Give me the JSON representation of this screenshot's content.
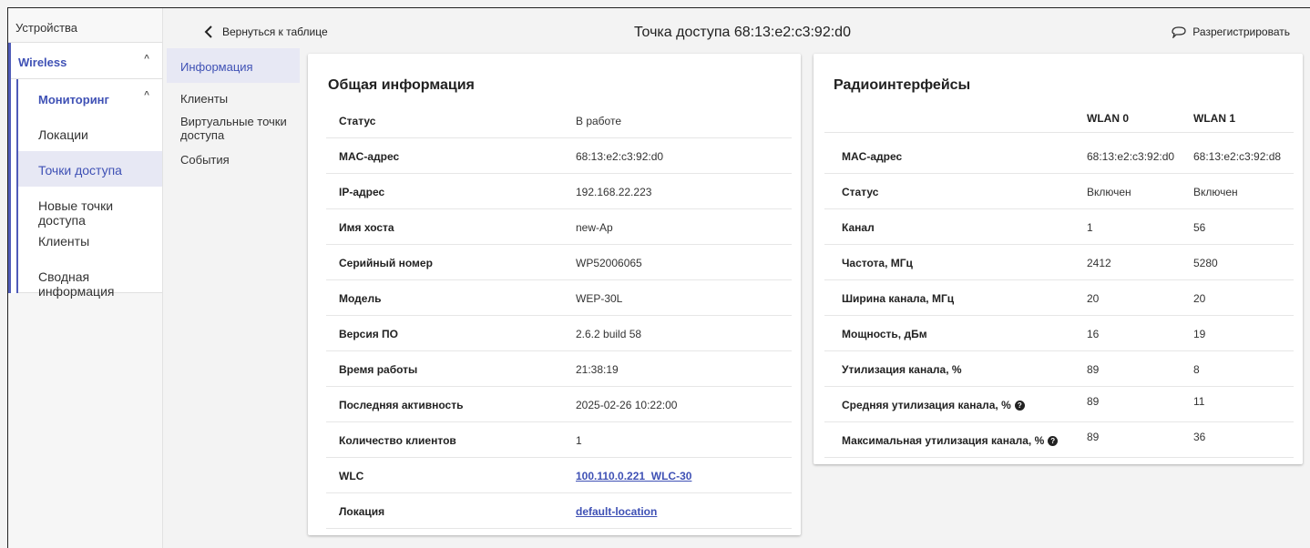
{
  "sidebar": {
    "devices": "Устройства",
    "wireless": "Wireless",
    "monitoring": "Мониторинг",
    "items": [
      {
        "label": "Локации"
      },
      {
        "label": "Точки доступа"
      },
      {
        "label": "Новые точки доступа"
      },
      {
        "label": "Клиенты"
      },
      {
        "label": "Сводная информация"
      }
    ]
  },
  "header": {
    "back_label": "Вернуться к таблице",
    "title": "Точка доступа 68:13:e2:c3:92:d0",
    "unregister_label": "Разрегистрировать"
  },
  "submenu": {
    "items": [
      {
        "label": "Информация"
      },
      {
        "label": "Клиенты"
      },
      {
        "label": "Виртуальные точки доступа"
      },
      {
        "label": "События"
      }
    ]
  },
  "general": {
    "title": "Общая информация",
    "rows": [
      {
        "key": "Статус",
        "value": "В работе"
      },
      {
        "key": "MAC-адрес",
        "value": "68:13:e2:c3:92:d0"
      },
      {
        "key": "IP-адрес",
        "value": "192.168.22.223"
      },
      {
        "key": "Имя хоста",
        "value": "new-Ap"
      },
      {
        "key": "Серийный номер",
        "value": "WP52006065"
      },
      {
        "key": "Модель",
        "value": "WEP-30L"
      },
      {
        "key": "Версия ПО",
        "value": "2.6.2 build 58"
      },
      {
        "key": "Время работы",
        "value": "21:38:19"
      },
      {
        "key": "Последняя активность",
        "value": "2025-02-26 10:22:00"
      },
      {
        "key": "Количество клиентов",
        "value": "1"
      },
      {
        "key": "WLC",
        "value": "100.110.0.221_WLC-30"
      },
      {
        "key": "Локация",
        "value": "default-location"
      }
    ]
  },
  "radio": {
    "title": "Радиоинтерфейсы",
    "columns": [
      "WLAN 0",
      "WLAN 1"
    ],
    "rows": [
      {
        "key": "MAC-адрес",
        "c1": "68:13:e2:c3:92:d0",
        "c2": "68:13:e2:c3:92:d8"
      },
      {
        "key": "Статус",
        "c1": "Включен",
        "c2": "Включен"
      },
      {
        "key": "Канал",
        "c1": "1",
        "c2": "56"
      },
      {
        "key": "Частота, МГц",
        "c1": "2412",
        "c2": "5280"
      },
      {
        "key": "Ширина канала, МГц",
        "c1": "20",
        "c2": "20"
      },
      {
        "key": "Мощность, дБм",
        "c1": "16",
        "c2": "19"
      },
      {
        "key": "Утилизация канала, %",
        "c1": "89",
        "c2": "8"
      },
      {
        "key": "Средняя утилизация канала, %",
        "c1": "89",
        "c2": "11"
      },
      {
        "key": "Максимальная утилизация канала, %",
        "c1": "89",
        "c2": "36"
      }
    ]
  },
  "icons": {
    "help": "?",
    "back": "‹",
    "caret_up": "^"
  }
}
